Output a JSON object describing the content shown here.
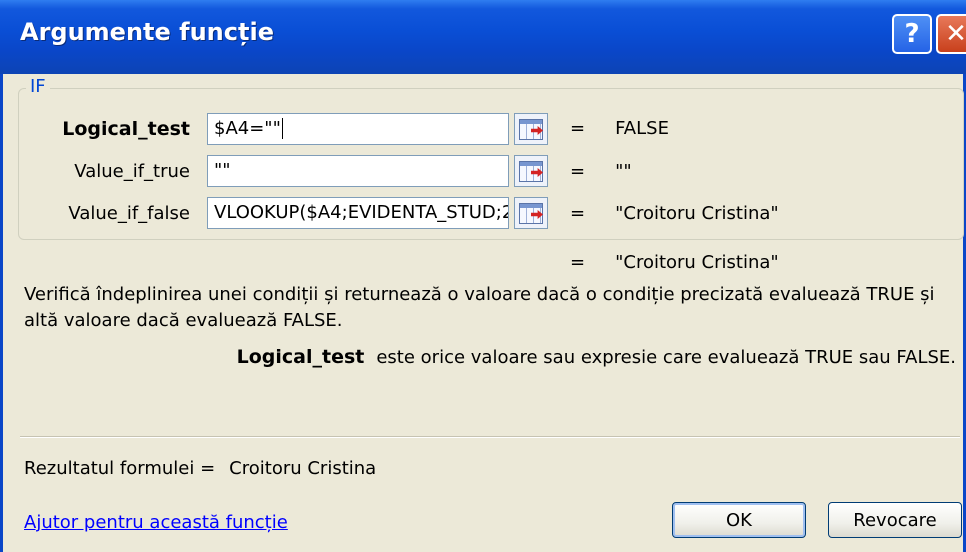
{
  "window": {
    "title": "Argumente funcție",
    "help_glyph": "?",
    "close_glyph": "✕"
  },
  "function_name": "IF",
  "arguments": [
    {
      "label": "Logical_test",
      "value": "$A4=\"\"",
      "result": "FALSE",
      "active": true
    },
    {
      "label": "Value_if_true",
      "value": "\"\"",
      "result": "\"\""
    },
    {
      "label": "Value_if_false",
      "value": "VLOOKUP($A4;EVIDENTA_STUD;2",
      "result": "\"Croitoru Cristina\""
    }
  ],
  "equals": "=",
  "function_result": "\"Croitoru Cristina\"",
  "description": "Verifică îndeplinirea unei condiții și returnează o valoare dacă o condiție precizată evaluează TRUE și altă valoare dacă evaluează FALSE.",
  "argument_help": {
    "name": "Logical_test",
    "text": "este orice valoare sau expresie care evaluează TRUE sau FALSE."
  },
  "formula_result": {
    "label": "Rezultatul formulei =",
    "value": "Croitoru Cristina"
  },
  "help_link": "Ajutor pentru această funcție",
  "buttons": {
    "ok": "OK",
    "cancel": "Revocare"
  },
  "icons": [
    "help-icon",
    "close-icon",
    "range-select-icon"
  ]
}
